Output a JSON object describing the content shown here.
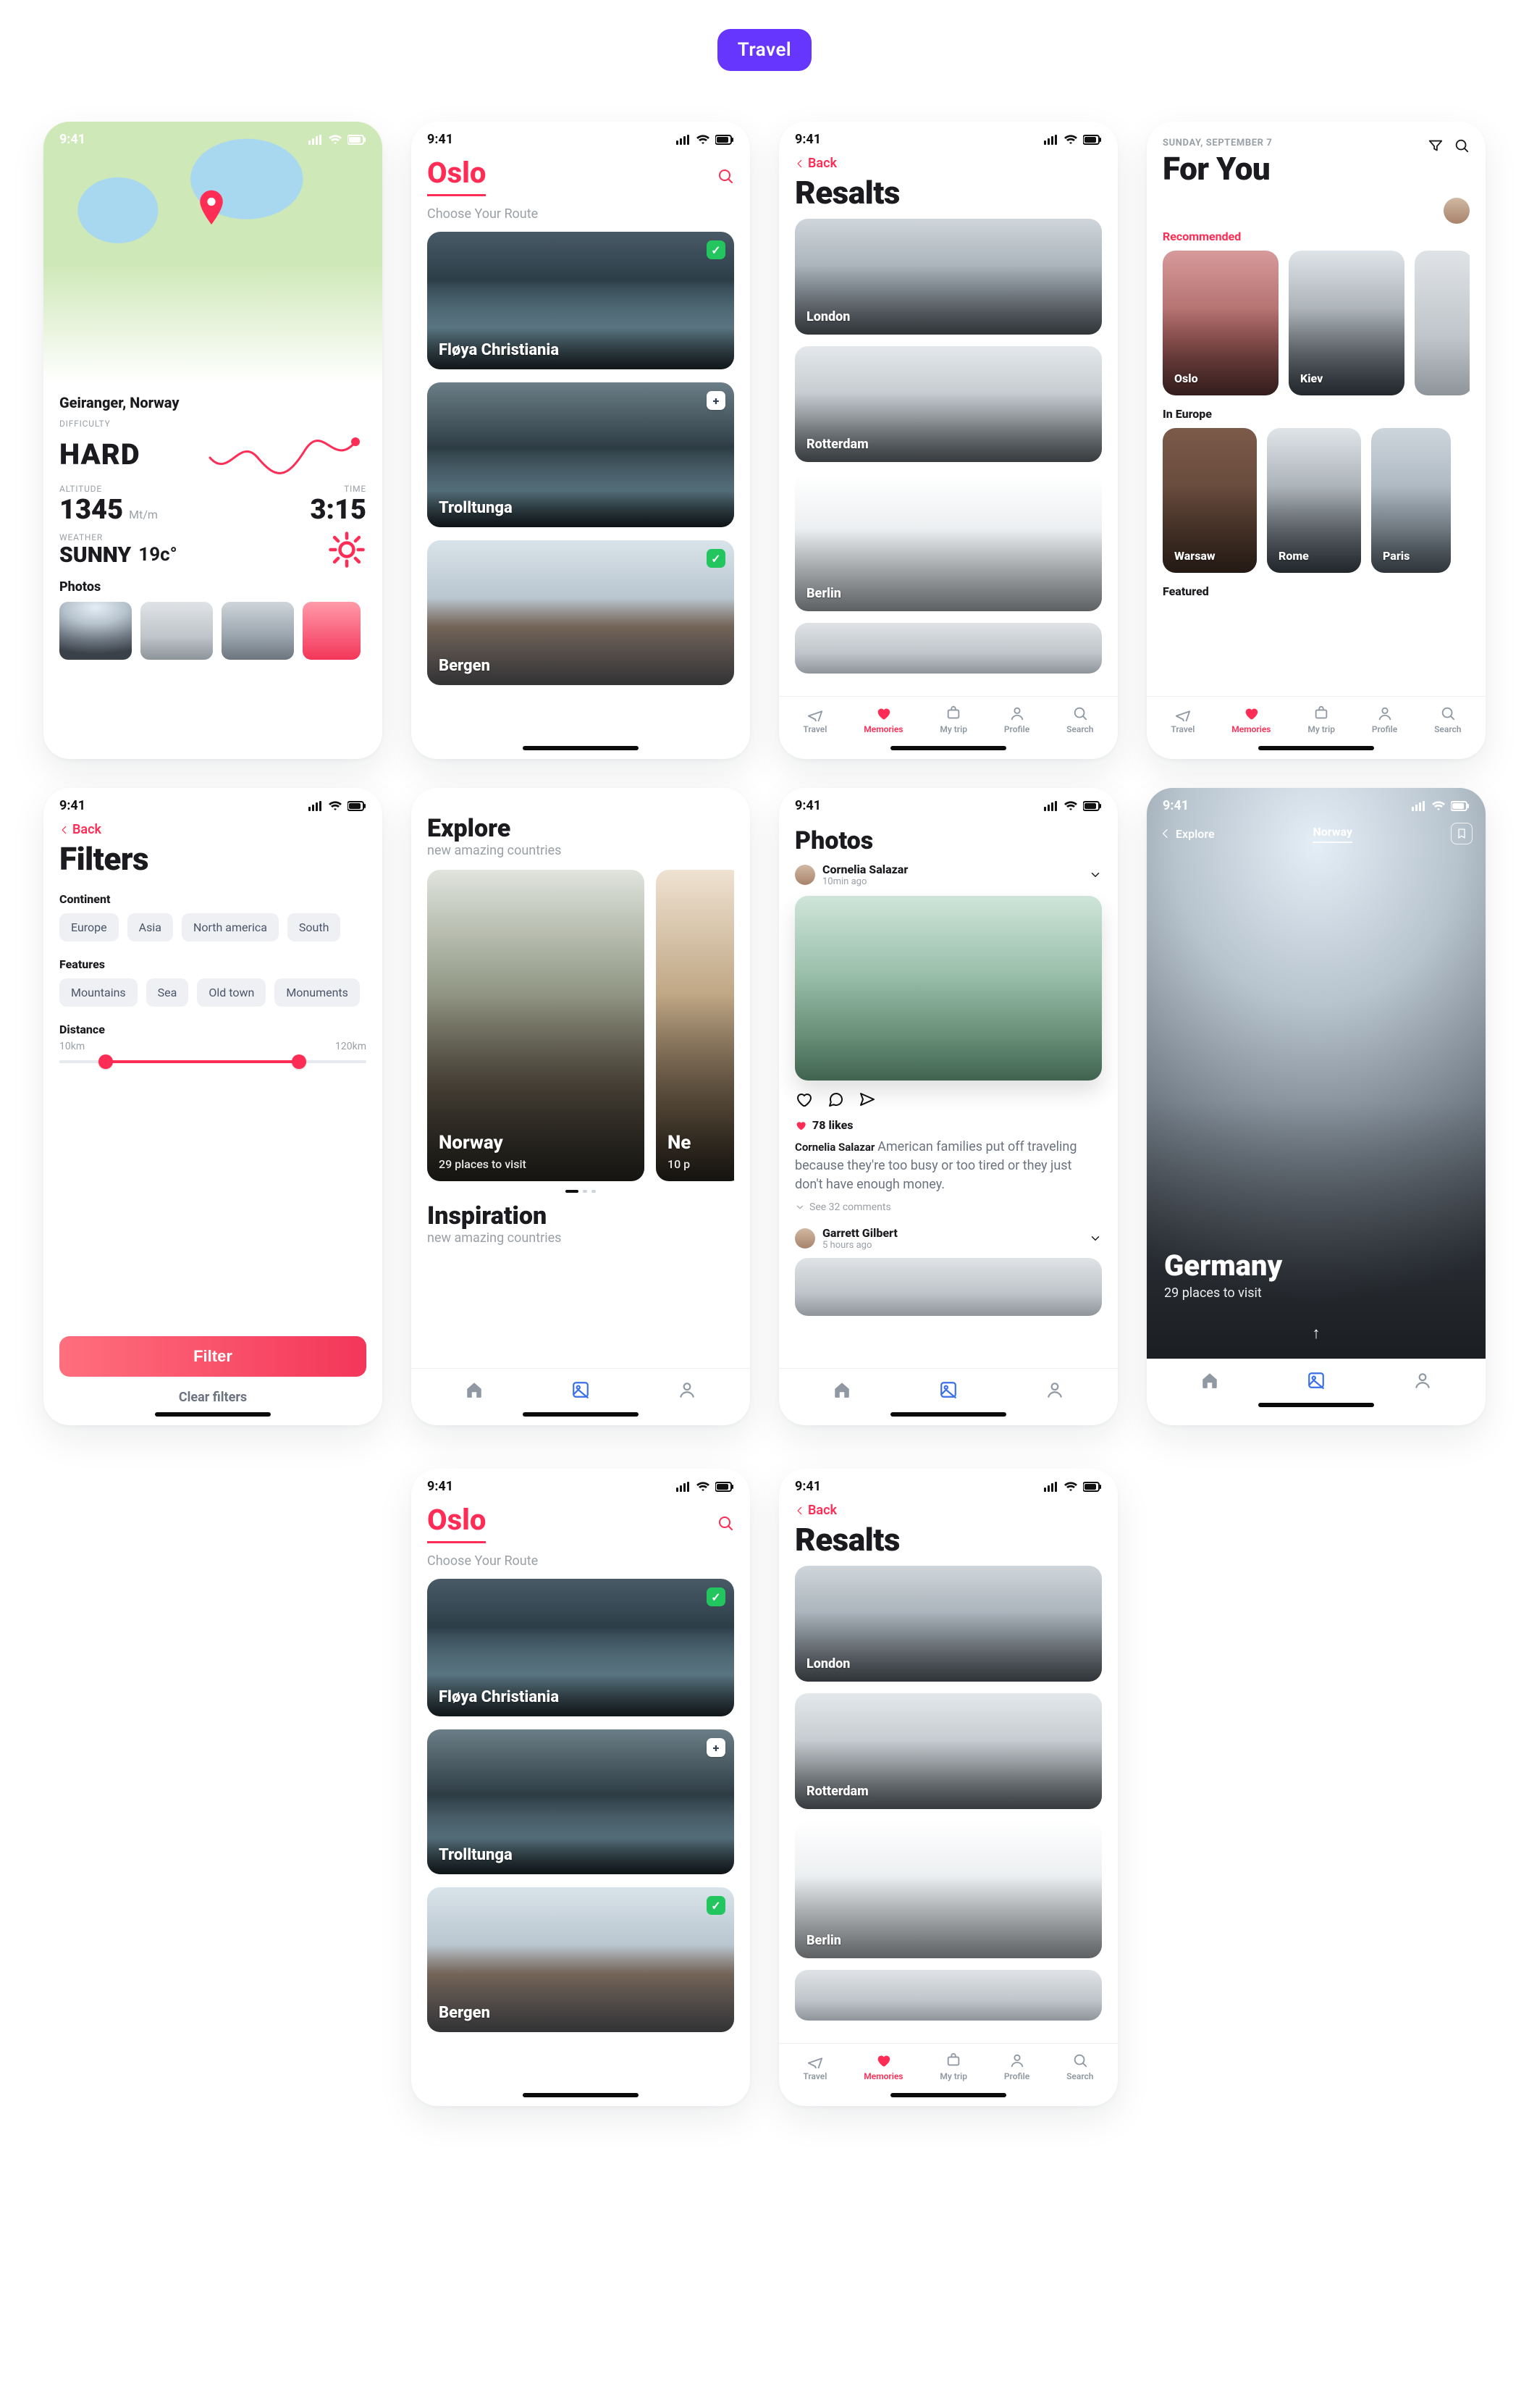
{
  "header": {
    "pill": "Travel"
  },
  "status": {
    "time": "9:41"
  },
  "tabs5": [
    {
      "key": "travel",
      "label": "Travel"
    },
    {
      "key": "memories",
      "label": "Memories"
    },
    {
      "key": "trip",
      "label": "My trip"
    },
    {
      "key": "profile",
      "label": "Profile"
    },
    {
      "key": "search",
      "label": "Search"
    }
  ],
  "screen1": {
    "place": "Geiranger, Norway",
    "labels": {
      "difficulty": "DIFFICULTY",
      "altitude": "ALTITUDE",
      "time": "TIME",
      "weather": "WEATHER",
      "photos": "Photos"
    },
    "difficulty": "HARD",
    "altitude_value": "1345",
    "altitude_unit": "Mt/m",
    "time_value": "3:15",
    "weather": "SUNNY",
    "temp": "19c°"
  },
  "screen2": {
    "city": "Oslo",
    "subtitle": "Choose Your Route",
    "routes": [
      {
        "name": "Fløya Christiania",
        "badge": "ok"
      },
      {
        "name": "Trolltunga",
        "badge": "add"
      },
      {
        "name": "Bergen",
        "badge": "ok"
      }
    ]
  },
  "screen3": {
    "back": "Back",
    "title": "Resalts",
    "cards": [
      "London",
      "Rotterdam",
      "Berlin"
    ]
  },
  "screen4": {
    "date": "SUNDAY, SEPTEMBER 7",
    "title": "For You",
    "sections": {
      "rec": {
        "label": "Recommended",
        "items": [
          "Oslo",
          "Kiev",
          ""
        ]
      },
      "eu": {
        "label": "In Europe",
        "items": [
          "Warsaw",
          "Rome",
          "Paris"
        ]
      },
      "featured": {
        "label": "Featured"
      }
    }
  },
  "screen5": {
    "back": "Back",
    "title": "Filters",
    "groups": {
      "continent": {
        "label": "Continent",
        "chips": [
          "Europe",
          "Asia",
          "North america",
          "South"
        ]
      },
      "features": {
        "label": "Features",
        "chips": [
          "Mountains",
          "Sea",
          "Old town",
          "Monuments"
        ]
      },
      "distance": {
        "label": "Distance",
        "min": "10km",
        "max": "120km",
        "start_pct": 15,
        "end_pct": 78
      }
    },
    "cta": "Filter",
    "clear": "Clear filters"
  },
  "screen6": {
    "title": "Explore",
    "subtitle": "new amazing countries",
    "cards": [
      {
        "name": "Norway",
        "sub": "29 places to visit"
      },
      {
        "name": "Ne",
        "sub": "10 p"
      }
    ],
    "title2": "Inspiration",
    "subtitle2": "new amazing countries"
  },
  "screen7": {
    "title": "Photos",
    "post": {
      "user": "Cornelia Salazar",
      "time": "10min ago",
      "likes": "78 likes",
      "caption_user": "Cornelia Salazar",
      "caption": "American families put off traveling because they're too busy or too tired or they just don't have enough money.",
      "see_comments": "See 32 comments"
    },
    "next": {
      "user": "Garrett Gilbert",
      "time": "5 hours ago"
    }
  },
  "screen8": {
    "back": "Explore",
    "country": "Norway",
    "title": "Germany",
    "sub": "29 places to visit"
  }
}
